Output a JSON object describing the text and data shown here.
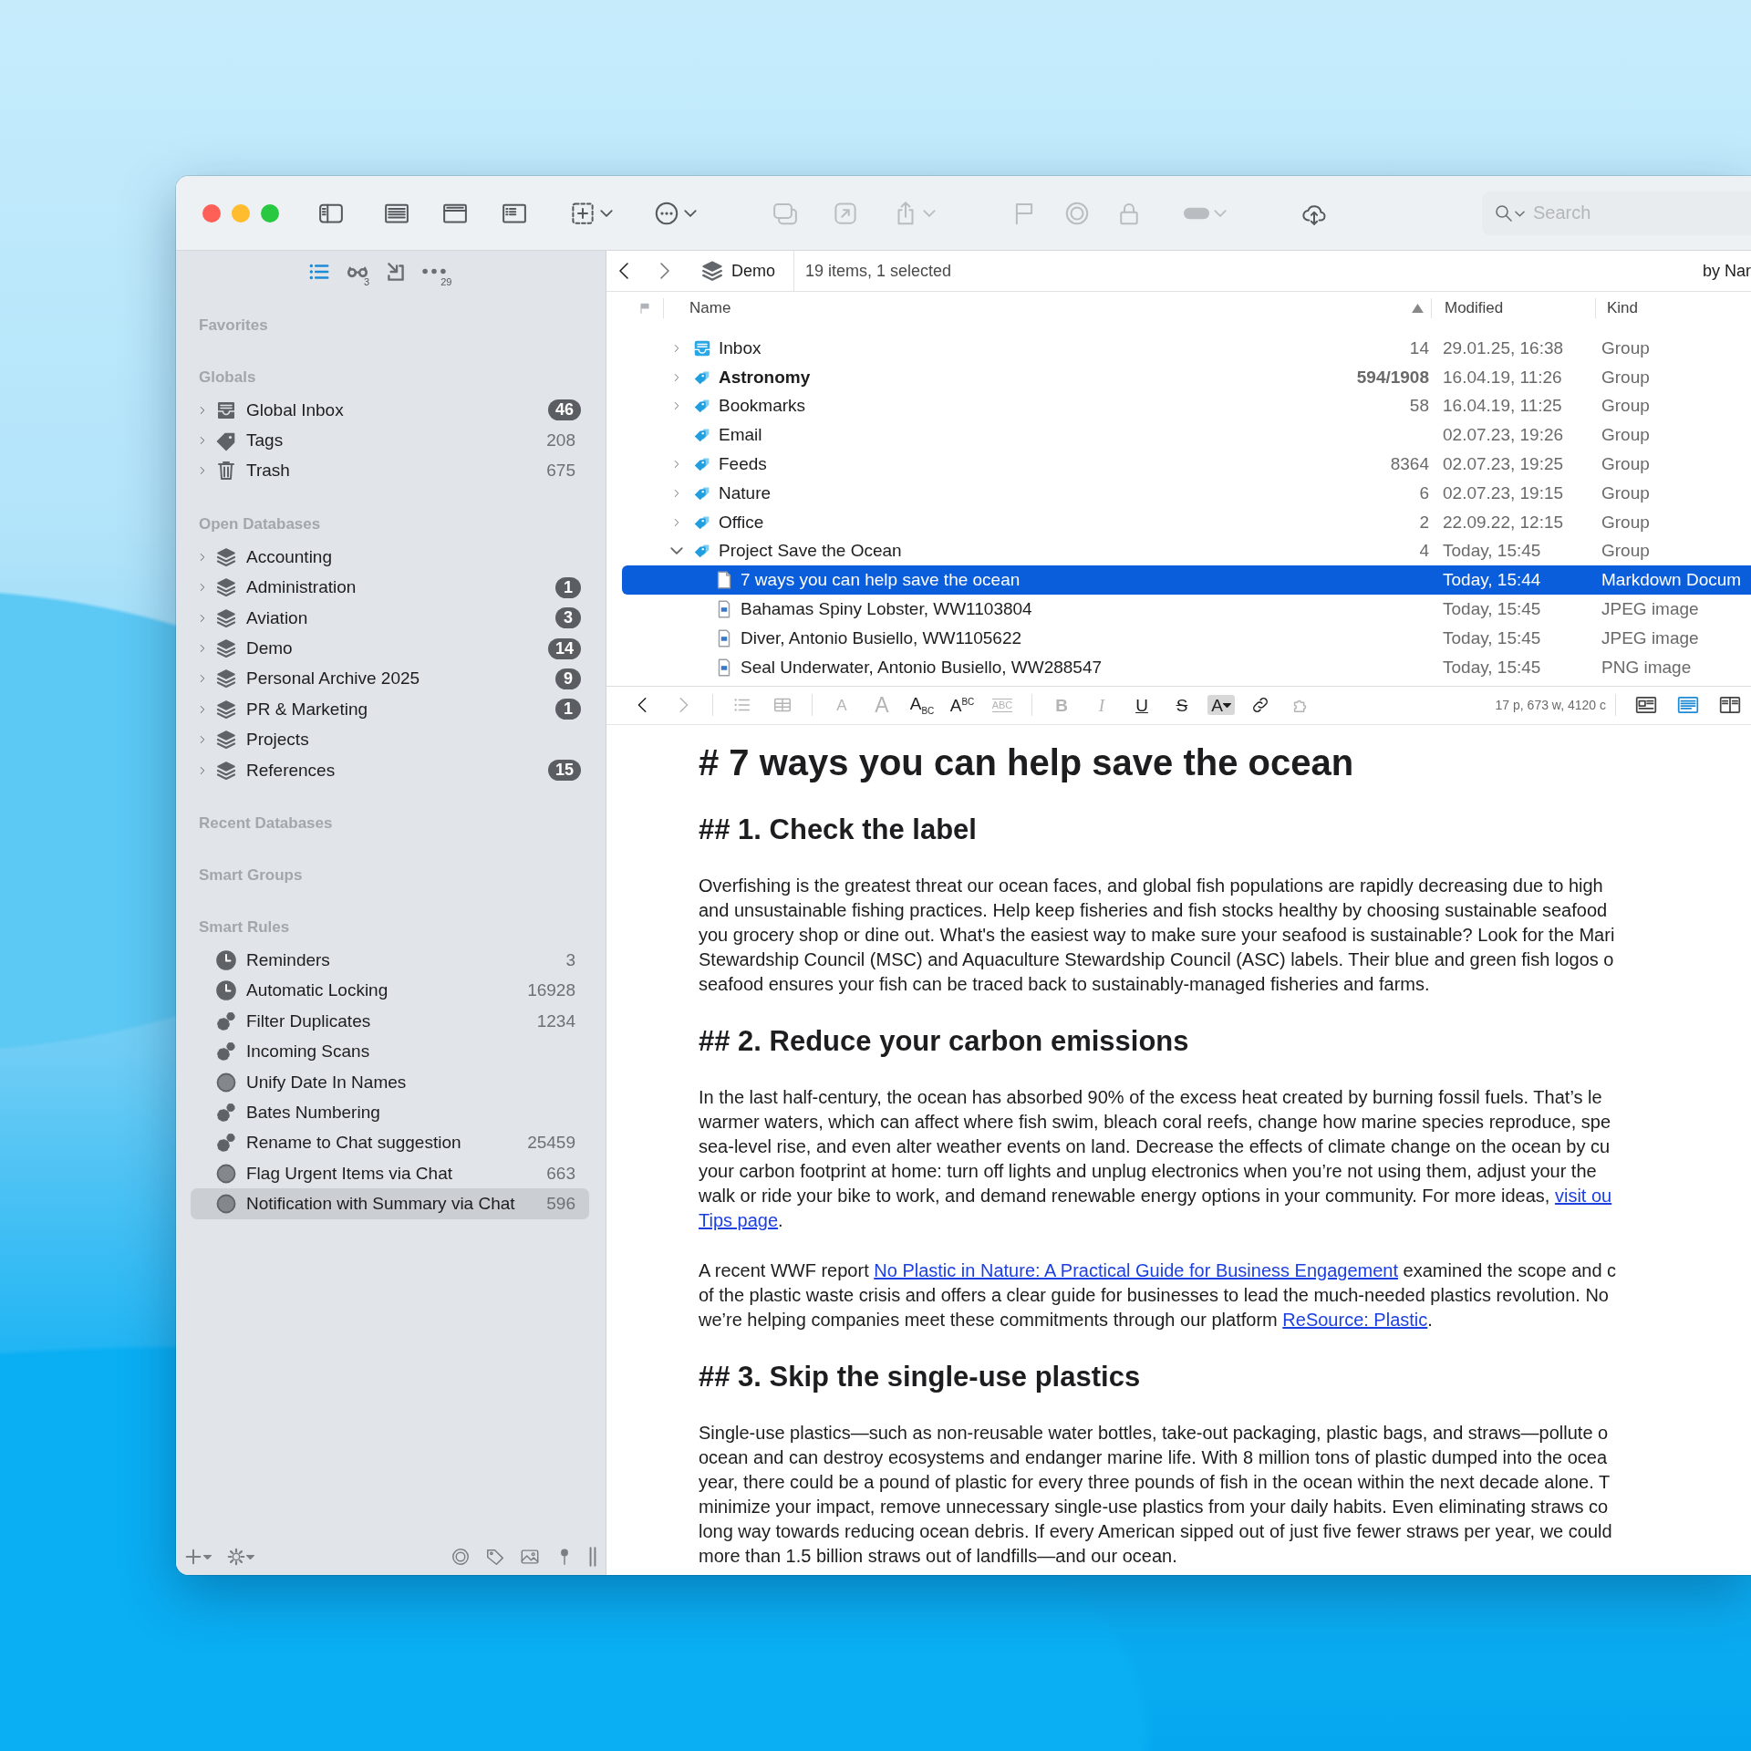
{
  "toolbar": [
    {
      "kind": "sidebar",
      "disabled": false,
      "menu": false
    },
    {
      "kind": "listview",
      "disabled": false,
      "menu": false
    },
    {
      "kind": "hsplit",
      "disabled": false,
      "menu": false
    },
    {
      "kind": "vsplit",
      "disabled": false,
      "menu": false
    },
    {
      "kind": "add",
      "disabled": false,
      "menu": true
    },
    {
      "kind": "more",
      "disabled": false,
      "menu": true
    },
    {
      "kind": "duplicate",
      "disabled": true,
      "menu": false
    },
    {
      "kind": "open",
      "disabled": true,
      "menu": false
    },
    {
      "kind": "share",
      "disabled": true,
      "menu": true
    },
    {
      "kind": "flag",
      "disabled": true,
      "menu": false
    },
    {
      "kind": "target",
      "disabled": true,
      "menu": false
    },
    {
      "kind": "lock",
      "disabled": true,
      "menu": false
    },
    {
      "kind": "label",
      "disabled": true,
      "menu": true
    },
    {
      "kind": "cloud",
      "disabled": false,
      "menu": false
    }
  ],
  "search": {
    "placeholder": "Search"
  },
  "sidebar": {
    "tabs": [
      {
        "kind": "tablist",
        "selected": true
      },
      {
        "kind": "glasses",
        "count": "3",
        "selected": false
      },
      {
        "kind": "importtab",
        "selected": false
      },
      {
        "kind": "dots",
        "count": "29",
        "selected": false
      }
    ],
    "sections": [
      {
        "title": "Favorites"
      },
      {
        "title": "Globals",
        "items": [
          {
            "label": "Global Inbox",
            "kind": "inboxtray",
            "count": "46",
            "badge": true,
            "expandable": true,
            "selected": false
          },
          {
            "label": "Tags",
            "kind": "tagfilled",
            "count": "208",
            "badge": false,
            "expandable": true,
            "selected": false
          },
          {
            "label": "Trash",
            "kind": "trash",
            "count": "675",
            "badge": false,
            "expandable": true,
            "selected": false
          }
        ]
      },
      {
        "title": "Open Databases",
        "items": [
          {
            "label": "Accounting",
            "kind": "database",
            "expandable": true,
            "selected": false
          },
          {
            "label": "Administration",
            "kind": "database",
            "count": "1",
            "badge": true,
            "expandable": true,
            "selected": false
          },
          {
            "label": "Aviation",
            "kind": "database",
            "count": "3",
            "badge": true,
            "expandable": true,
            "selected": false
          },
          {
            "label": "Demo",
            "kind": "database",
            "count": "14",
            "badge": true,
            "expandable": true,
            "selected": false
          },
          {
            "label": "Personal Archive 2025",
            "kind": "database",
            "count": "9",
            "badge": true,
            "expandable": true,
            "selected": false
          },
          {
            "label": "PR & Marketing",
            "kind": "database",
            "count": "1",
            "badge": true,
            "expandable": true,
            "selected": false
          },
          {
            "label": "Projects",
            "kind": "database",
            "expandable": true,
            "selected": false
          },
          {
            "label": "References",
            "kind": "database",
            "count": "15",
            "badge": true,
            "expandable": true,
            "selected": false
          }
        ]
      },
      {
        "title": "Recent Databases"
      },
      {
        "title": "Smart Groups"
      },
      {
        "title": "Smart Rules",
        "items": [
          {
            "label": "Reminders",
            "kind": "clock",
            "count": "3",
            "badge": false,
            "expandable": false,
            "selected": false
          },
          {
            "label": "Automatic Locking",
            "kind": "clock",
            "count": "16928",
            "badge": false,
            "expandable": false,
            "selected": false
          },
          {
            "label": "Filter Duplicates",
            "kind": "gears",
            "count": "1234",
            "badge": false,
            "expandable": false,
            "selected": false
          },
          {
            "label": "Incoming Scans",
            "kind": "gears",
            "expandable": false,
            "selected": false
          },
          {
            "label": "Unify Date In Names",
            "kind": "ring",
            "expandable": false,
            "selected": false
          },
          {
            "label": "Bates Numbering",
            "kind": "gears",
            "expandable": false,
            "selected": false
          },
          {
            "label": "Rename to Chat suggestion",
            "kind": "gears",
            "count": "25459",
            "badge": false,
            "expandable": false,
            "selected": false
          },
          {
            "label": "Flag Urgent Items via Chat",
            "kind": "ring",
            "count": "663",
            "badge": false,
            "expandable": false,
            "selected": false
          },
          {
            "label": "Notification with Summary via Chat",
            "kind": "ring",
            "count": "596",
            "badge": false,
            "expandable": false,
            "selected": true
          }
        ]
      }
    ]
  },
  "path_bar": {
    "location": "Demo",
    "summary": "19 items, 1 selected",
    "sort": "by Nar"
  },
  "list": {
    "columns": [
      {
        "label": "Name",
        "sorted": true
      },
      {
        "label": "Modified",
        "sorted": false
      },
      {
        "label": "Kind",
        "sorted": false
      }
    ],
    "rows": [
      {
        "name": "Inbox",
        "kind": "inboxblue",
        "count": "14",
        "modified": "29.01.25, 16:38",
        "type": "Group",
        "bold": false,
        "expanded": false,
        "selected": false
      },
      {
        "name": "Astronomy",
        "kind": "group",
        "count": "594/1908",
        "modified": "16.04.19, 11:26",
        "type": "Group",
        "bold": true,
        "expanded": false,
        "selected": false
      },
      {
        "name": "Bookmarks",
        "kind": "group",
        "count": "58",
        "modified": "16.04.19, 11:25",
        "type": "Group",
        "bold": false,
        "expanded": false,
        "selected": false
      },
      {
        "name": "Email",
        "kind": "group",
        "modified": "02.07.23, 19:26",
        "type": "Group",
        "bold": false,
        "selected": false
      },
      {
        "name": "Feeds",
        "kind": "group",
        "count": "8364",
        "modified": "02.07.23, 19:25",
        "type": "Group",
        "bold": false,
        "expanded": false,
        "selected": false
      },
      {
        "name": "Nature",
        "kind": "group",
        "count": "6",
        "modified": "02.07.23, 19:15",
        "type": "Group",
        "bold": false,
        "expanded": false,
        "selected": false
      },
      {
        "name": "Office",
        "kind": "group",
        "count": "2",
        "modified": "22.09.22, 12:15",
        "type": "Group",
        "bold": false,
        "expanded": false,
        "selected": false
      },
      {
        "name": "Project Save the Ocean",
        "kind": "group",
        "count": "4",
        "modified": "Today, 15:45",
        "type": "Group",
        "bold": false,
        "expanded": true,
        "selected": false,
        "children": [
          {
            "name": "7 ways you can help save the ocean",
            "kind": "mddoc",
            "modified": "Today, 15:44",
            "type": "Markdown Docum",
            "bold": false,
            "selected": true
          },
          {
            "name": "Bahamas Spiny Lobster, WW1103804",
            "kind": "imgfile",
            "modified": "Today, 15:45",
            "type": "JPEG image",
            "bold": false,
            "selected": false
          },
          {
            "name": "Diver, Antonio Busiello, WW1105622",
            "kind": "imgfile",
            "modified": "Today, 15:45",
            "type": "JPEG image",
            "bold": false,
            "selected": false
          },
          {
            "name": "Seal Underwater, Antonio Busiello, WW288547",
            "kind": "imgfile",
            "modified": "Today, 15:45",
            "type": "PNG image",
            "bold": false,
            "selected": false
          }
        ]
      }
    ]
  },
  "editor": {
    "toolbar": [
      [
        {
          "kind": "back",
          "disabled": false
        },
        {
          "kind": "fwd",
          "disabled": true
        }
      ],
      [
        {
          "kind": "bulletlist",
          "disabled": true
        },
        {
          "kind": "table",
          "disabled": true
        }
      ],
      [
        {
          "kind": "smaller",
          "label": "A",
          "disabled": true
        },
        {
          "kind": "larger",
          "label": "A",
          "disabled": true
        },
        {
          "kind": "sub",
          "label": "A$_{BC}$",
          "disabled": false
        },
        {
          "kind": "sup",
          "label": "A$^{BC}$",
          "disabled": false
        },
        {
          "kind": "caps",
          "label": "ABC",
          "disabled": true
        }
      ],
      [
        {
          "kind": "bold",
          "label": "B",
          "disabled": true
        },
        {
          "kind": "italic",
          "label": "I",
          "disabled": true
        },
        {
          "kind": "underline",
          "label": "U",
          "disabled": false
        },
        {
          "kind": "strike",
          "label": "S",
          "disabled": false
        },
        {
          "kind": "color",
          "label": "A",
          "disabled": false
        },
        {
          "kind": "link",
          "disabled": false
        },
        {
          "kind": "puzzle",
          "disabled": true
        }
      ]
    ],
    "stats": "17 p, 673 w, 4120 c",
    "view_modes": [
      {
        "kind": "viewpreview",
        "selected": false
      },
      {
        "kind": "viewtext",
        "selected": true
      },
      {
        "kind": "viewsplit",
        "selected": false
      }
    ],
    "blocks": [
      {
        "kind": "h1",
        "text": "# 7 ways you can help save the ocean"
      },
      {
        "kind": "h2",
        "text": "## 1. Check the label"
      },
      {
        "kind": "p",
        "lines": [
          [
            {
              "text": "Overfishing is the greatest threat our ocean faces, and global fish populations are rapidly decreasing due to high"
            }
          ],
          [
            {
              "text": "and unsustainable fishing practices. Help keep fisheries and fish stocks healthy by choosing sustainable seafood"
            }
          ],
          [
            {
              "text": "you grocery shop or dine out. What's the easiest way to make sure your seafood is sustainable? Look for the Mari"
            }
          ],
          [
            {
              "text": "Stewardship Council (MSC) and Aquaculture Stewardship Council (ASC) labels. Their blue and green fish logos o"
            }
          ],
          [
            {
              "text": "seafood ensures your fish can be traced back to sustainably-managed fisheries and farms."
            }
          ]
        ]
      },
      {
        "kind": "h2",
        "text": "## 2. Reduce your carbon emissions"
      },
      {
        "kind": "p",
        "lines": [
          [
            {
              "text": "In the last half-century, the ocean has absorbed 90% of the excess heat created by burning fossil fuels. That’s le"
            }
          ],
          [
            {
              "text": "warmer waters, which can affect where fish swim, bleach coral reefs, change how marine species reproduce, spe"
            }
          ],
          [
            {
              "text": "sea-level rise, and even alter weather events on land. Decrease the effects of climate change on the ocean by cu"
            }
          ],
          [
            {
              "text": "your carbon footprint at home: turn off lights and unplug electronics when you’re not using them, adjust your the"
            }
          ],
          [
            {
              "text": "walk or ride your bike to work, and demand renewable energy options in your community. For more ideas, "
            },
            {
              "text": "visit ou",
              "link": true
            }
          ],
          [
            {
              "text": "Tips page",
              "link": true
            },
            {
              "text": "."
            }
          ]
        ]
      },
      {
        "kind": "p",
        "lines": [
          [
            {
              "text": "A recent WWF report "
            },
            {
              "text": "No Plastic in Nature: A Practical Guide for Business Engagement",
              "link": true
            },
            {
              "text": " examined the scope and c"
            }
          ],
          [
            {
              "text": "of the plastic waste crisis and offers a clear guide for businesses to lead the much-needed plastics revolution. No"
            }
          ],
          [
            {
              "text": "we’re helping companies meet these commitments through our platform "
            },
            {
              "text": "ReSource: Plastic",
              "link": true
            },
            {
              "text": "."
            }
          ]
        ]
      },
      {
        "kind": "h2",
        "text": "## 3. Skip the single-use plastics"
      },
      {
        "kind": "p",
        "lines": [
          [
            {
              "text": "Single-use plastics—such as non-reusable water bottles, take-out packaging, plastic bags, and straws—pollute o"
            }
          ],
          [
            {
              "text": "ocean and can destroy ecosystems and endanger marine life. With 8 million tons of plastic dumped into the ocea"
            }
          ],
          [
            {
              "text": "year, there could be a pound of plastic for every three pounds of fish in the ocean within the next decade alone. T"
            }
          ],
          [
            {
              "text": "minimize your impact, remove unnecessary single-use plastics from your daily habits. Even eliminating straws co"
            }
          ],
          [
            {
              "text": "long way towards reducing ocean debris. If every American sipped out of just five fewer straws per year, we could"
            }
          ],
          [
            {
              "text": "more than 1.5 billion straws out of landfills—and our ocean."
            }
          ]
        ]
      }
    ]
  }
}
